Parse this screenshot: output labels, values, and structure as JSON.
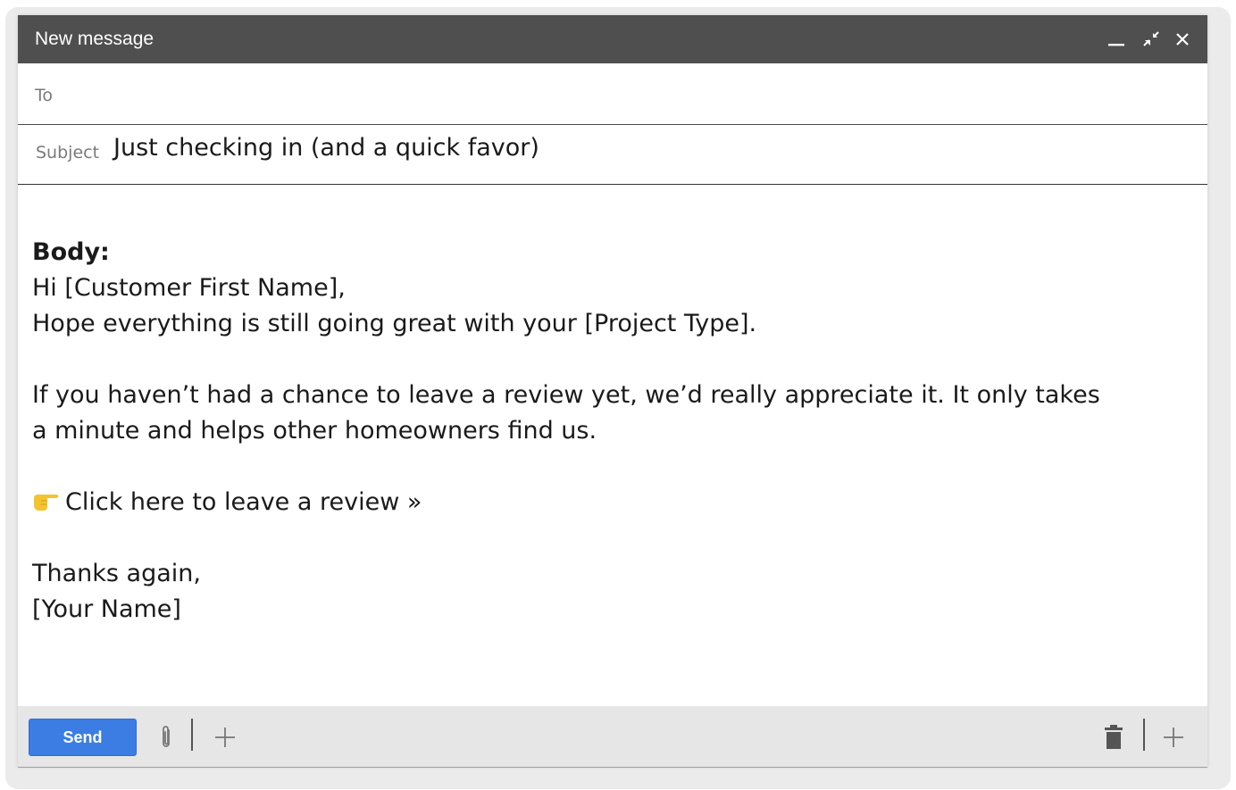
{
  "window": {
    "title": "New message",
    "controls": {
      "minimize_icon": "minimize-icon",
      "exit_fullscreen_icon": "exit-fullscreen-icon",
      "close_icon": "close-icon"
    }
  },
  "compose": {
    "to_label": "To",
    "to_value": "",
    "subject_label": "Subject",
    "subject_value": "Just checking in (and a quick favor)"
  },
  "body": {
    "heading": "Body:",
    "greeting": "Hi [Customer First Name],",
    "line_hope": "Hope everything is still going great with your [Project Type].",
    "paragraph_review_line1": "If you haven’t had a chance to leave a review yet, we’d really appreciate it. It only takes",
    "paragraph_review_line2": "a minute and helps other homeowners find us.",
    "review_link_icon": "pointing-hand-icon",
    "review_link_text": "Click here to leave a review »",
    "signoff": "Thanks again,",
    "signature": "[Your Name]"
  },
  "toolbar": {
    "send_label": "Send",
    "attach_icon": "paperclip-icon",
    "insert_icon": "plus-icon",
    "delete_icon": "trash-icon",
    "more_icon": "plus-icon"
  },
  "colors": {
    "titlebar": "#4f4f4f",
    "send_button": "#3c7de4",
    "bottombar": "#e6e6e6",
    "frame": "#ebebeb"
  }
}
